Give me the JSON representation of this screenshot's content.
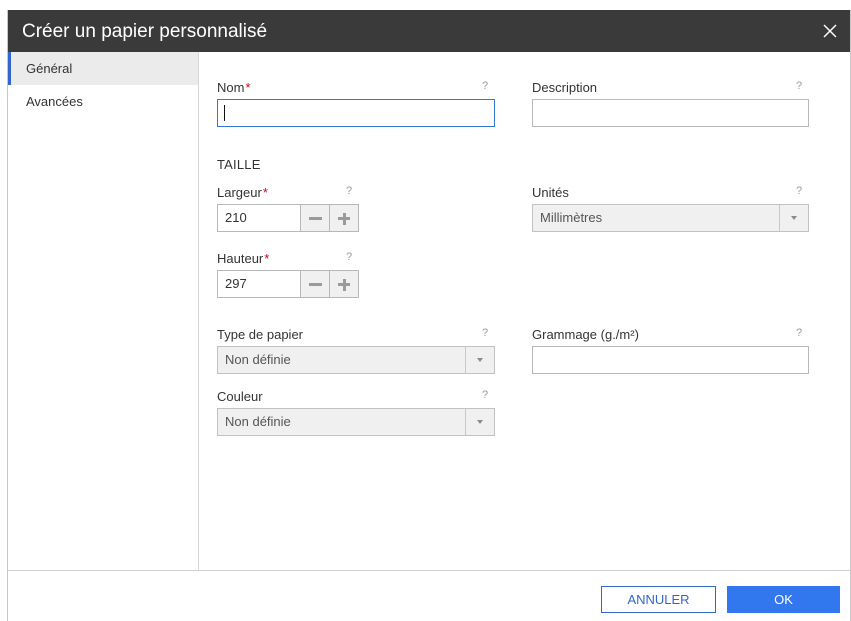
{
  "dialog": {
    "title": "Créer un papier personnalisé",
    "close_icon": "close-icon"
  },
  "sidebar": {
    "items": [
      {
        "label": "Général",
        "active": true
      },
      {
        "label": "Avancées",
        "active": false
      }
    ]
  },
  "form": {
    "name": {
      "label": "Nom",
      "required_mark": "*",
      "help": "?",
      "value": ""
    },
    "description": {
      "label": "Description",
      "help": "?",
      "value": ""
    },
    "size_section": "TAILLE",
    "width": {
      "label": "Largeur",
      "required_mark": "*",
      "help": "?",
      "value": "210"
    },
    "height": {
      "label": "Hauteur",
      "required_mark": "*",
      "help": "?",
      "value": "297"
    },
    "units": {
      "label": "Unités",
      "help": "?",
      "value": "Millimètres"
    },
    "paper_type": {
      "label": "Type de papier",
      "help": "?",
      "value": "Non définie"
    },
    "weight": {
      "label": "Grammage (g./m²)",
      "help": "?",
      "value": ""
    },
    "color": {
      "label": "Couleur",
      "help": "?",
      "value": "Non définie"
    }
  },
  "footer": {
    "cancel_label": "ANNULER",
    "ok_label": "OK"
  },
  "colors": {
    "titlebar": "#3a3a3a",
    "accent": "#3377ee",
    "required": "#d0021b"
  }
}
